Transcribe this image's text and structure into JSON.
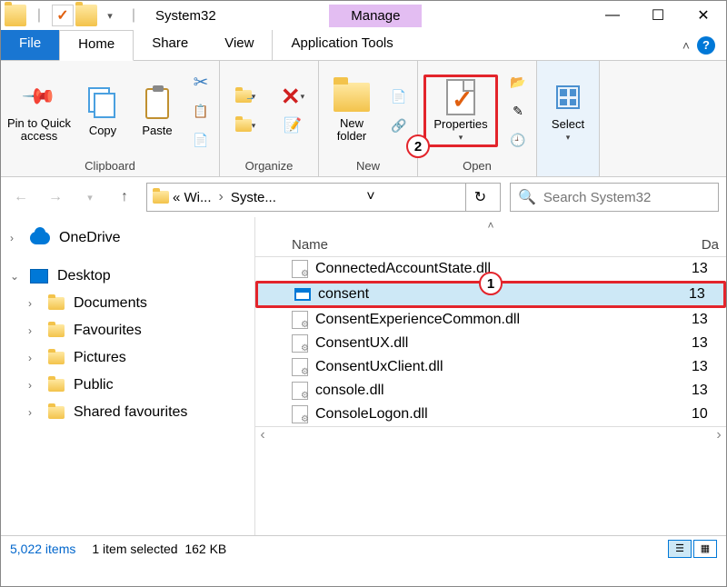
{
  "titlebar": {
    "title": "System32",
    "manage": "Manage"
  },
  "tabs": {
    "file": "File",
    "home": "Home",
    "share": "Share",
    "view": "View",
    "apptools": "Application Tools"
  },
  "ribbon": {
    "clipboard": {
      "label": "Clipboard",
      "pin": "Pin to Quick access",
      "copy": "Copy",
      "paste": "Paste"
    },
    "organize": {
      "label": "Organize"
    },
    "new": {
      "label": "New",
      "newfolder": "New folder"
    },
    "open": {
      "label": "Open",
      "properties": "Properties"
    },
    "select": {
      "label": "Select"
    }
  },
  "nav": {
    "crumb1": "« Wi...",
    "crumb2": "Syste...",
    "search_placeholder": "Search System32"
  },
  "tree": {
    "onedrive": "OneDrive",
    "desktop": "Desktop",
    "items": [
      "Documents",
      "Favourites",
      "Pictures",
      "Public",
      "Shared favourites"
    ]
  },
  "columns": {
    "name": "Name",
    "date": "Da"
  },
  "files": [
    {
      "name": "ConnectedAccountState.dll",
      "date": "13",
      "type": "dll"
    },
    {
      "name": "consent",
      "date": "13",
      "type": "exe",
      "selected": true
    },
    {
      "name": "ConsentExperienceCommon.dll",
      "date": "13",
      "type": "dll"
    },
    {
      "name": "ConsentUX.dll",
      "date": "13",
      "type": "dll"
    },
    {
      "name": "ConsentUxClient.dll",
      "date": "13",
      "type": "dll"
    },
    {
      "name": "console.dll",
      "date": "13",
      "type": "dll"
    },
    {
      "name": "ConsoleLogon.dll",
      "date": "10",
      "type": "dll"
    }
  ],
  "status": {
    "count": "5,022 items",
    "selected": "1 item selected",
    "size": "162 KB"
  },
  "callouts": {
    "c1": "1",
    "c2": "2"
  }
}
